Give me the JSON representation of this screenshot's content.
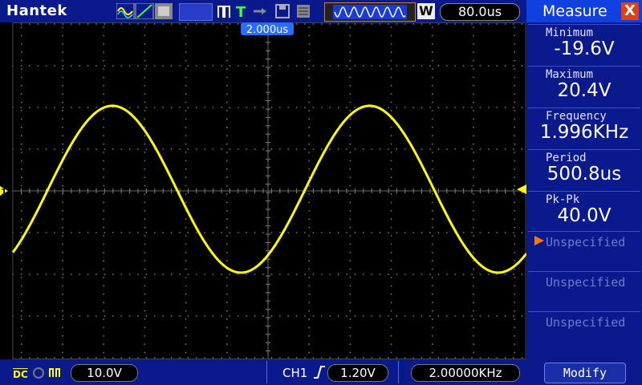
{
  "topbar": {
    "brand": "Hantek",
    "time_div": "80.0us",
    "mode_letter": "W",
    "trigger_position": "2.000us"
  },
  "measure_panel": {
    "title": "Measure",
    "close_label": "X",
    "items": [
      {
        "label": "Minimum",
        "value": "-19.6V"
      },
      {
        "label": "Maximum",
        "value": "20.4V"
      },
      {
        "label": "Frequency",
        "value": "1.996KHz"
      },
      {
        "label": "Period",
        "value": "500.8us"
      },
      {
        "label": "Pk-Pk",
        "value": "40.0V"
      }
    ],
    "unspecified": [
      "Unspecified",
      "Unspecified",
      "Unspecified"
    ],
    "modify_label": "Modify"
  },
  "bottombar": {
    "coupling": "DC",
    "volts_div": "10.0V",
    "trigger_channel": "CH1",
    "trigger_level": "1.20V",
    "freq_counter": "2.00000KHz"
  },
  "channel_marker": "1",
  "colors": {
    "trace": "#ffff00",
    "bar_bg": "#0a1a8c",
    "title_bg": "#1040e0",
    "close_bg": "#e04010"
  },
  "waveform": {
    "channel": "CH1",
    "shape": "sine",
    "amplitude_v": 20,
    "offset_v": 0.4,
    "period_us": 500.8,
    "time_div_us": 80
  }
}
